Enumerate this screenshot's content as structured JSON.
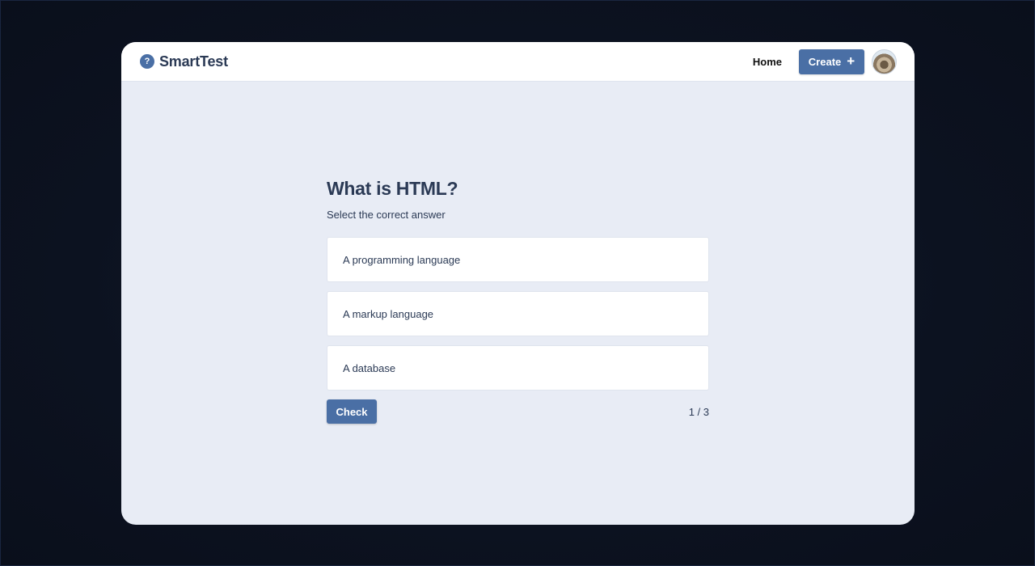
{
  "brand": {
    "name": "SmartTest",
    "icon": "?"
  },
  "nav": {
    "home_label": "Home",
    "create_label": "Create",
    "create_icon": "+"
  },
  "quiz": {
    "title": "What is HTML?",
    "subtitle": "Select the correct answer",
    "options": [
      {
        "label": "A programming language"
      },
      {
        "label": "A markup language"
      },
      {
        "label": "A database"
      }
    ],
    "check_label": "Check",
    "progress": "1 / 3"
  },
  "colors": {
    "accent": "#4a6fa5",
    "text": "#2b3a55",
    "surface": "#e8ecf5"
  }
}
